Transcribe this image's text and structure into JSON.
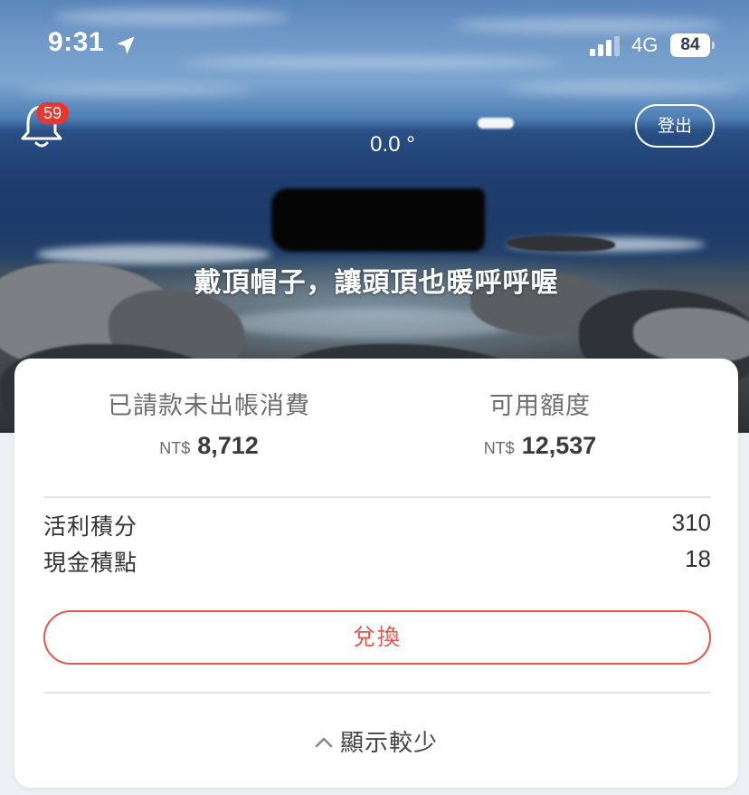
{
  "status_bar": {
    "time": "9:31",
    "network": "4G",
    "battery": "84",
    "location_icon": "location-arrow-icon",
    "signal_icon": "cellular-signal-icon"
  },
  "header": {
    "notification_icon": "bell-icon",
    "notification_count": "59",
    "temperature": "0.0 °",
    "logout_label": "登出",
    "slogan": "戴頂帽子，讓頭頂也暖呼呼喔"
  },
  "summary": {
    "unbilled": {
      "label": "已請款未出帳消費",
      "currency": "NT$",
      "amount": "8,712"
    },
    "available": {
      "label": "可用額度",
      "currency": "NT$",
      "amount": "12,537"
    }
  },
  "points": [
    {
      "label": "活利積分",
      "value": "310"
    },
    {
      "label": "現金積點",
      "value": "18"
    }
  ],
  "redeem_label": "兌換",
  "show_less_label": "顯示較少",
  "colors": {
    "accent": "#e4584d",
    "badge": "#e8382e",
    "background": "#eef0f5"
  }
}
